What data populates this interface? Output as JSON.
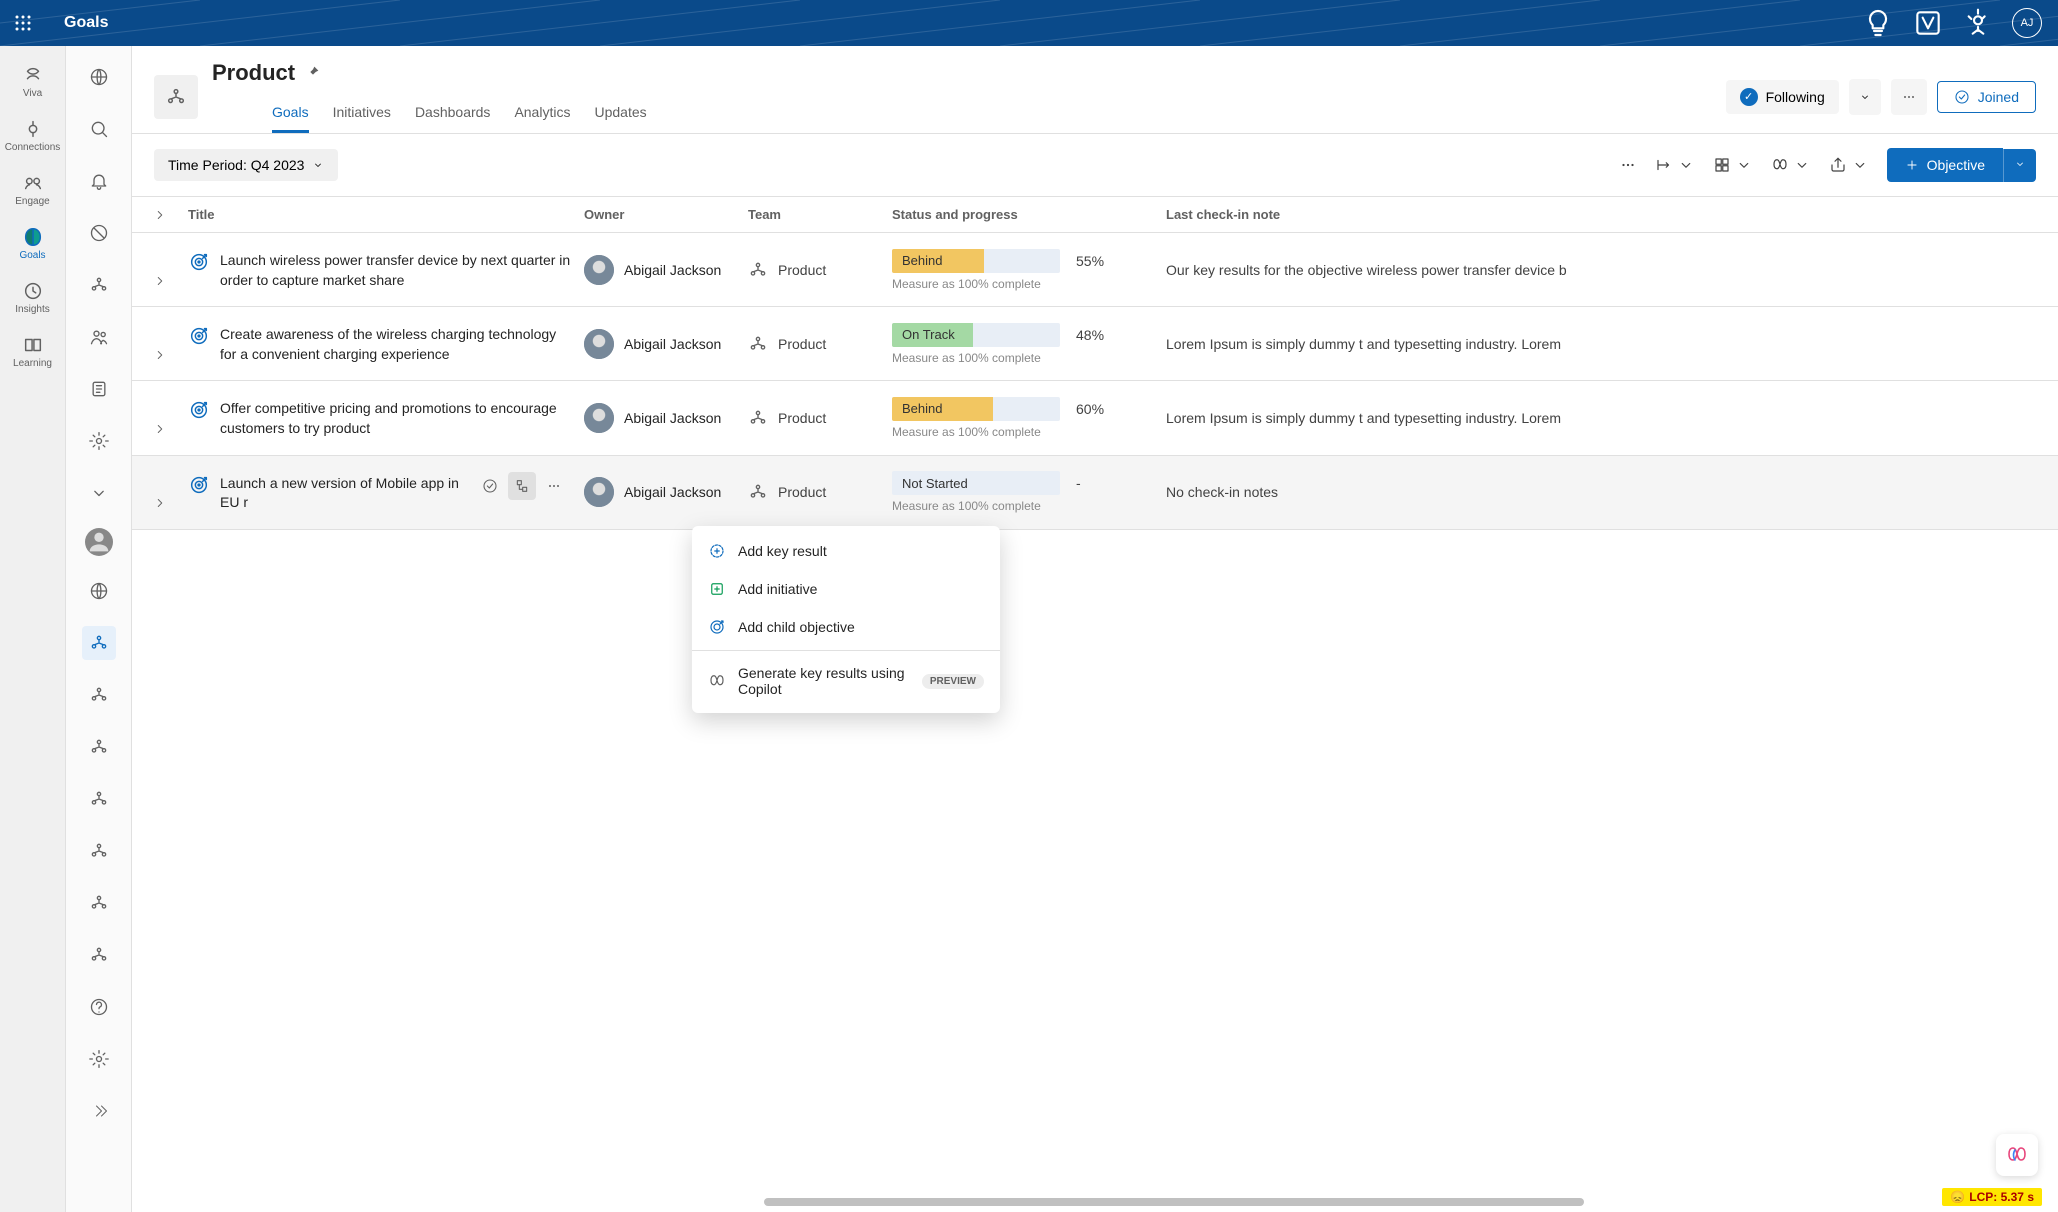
{
  "header": {
    "app_title": "Goals",
    "avatar_initials": "AJ"
  },
  "left_rail": {
    "items": [
      {
        "label": "Viva"
      },
      {
        "label": "Connections"
      },
      {
        "label": "Engage"
      },
      {
        "label": "Goals"
      },
      {
        "label": "Insights"
      },
      {
        "label": "Learning"
      }
    ]
  },
  "page": {
    "title": "Product",
    "following_label": "Following",
    "joined_label": "Joined",
    "tabs": [
      "Goals",
      "Initiatives",
      "Dashboards",
      "Analytics",
      "Updates"
    ],
    "active_tab": "Goals"
  },
  "toolbar": {
    "time_period": "Time Period: Q4 2023",
    "objective_label": "Objective"
  },
  "table": {
    "headers": {
      "title": "Title",
      "owner": "Owner",
      "team": "Team",
      "status": "Status and progress",
      "note": "Last check-in note"
    },
    "rows": [
      {
        "title": "Launch wireless power transfer device by next quarter in order to capture market share",
        "owner": "Abigail Jackson",
        "team": "Product",
        "status_label": "Behind",
        "status_kind": "behind",
        "percent": "55%",
        "fill": 55,
        "measure": "Measure as 100% complete",
        "note": "Our key results for the objective wireless power transfer device b"
      },
      {
        "title": "Create awareness of the wireless charging technology for a convenient charging experience",
        "owner": "Abigail Jackson",
        "team": "Product",
        "status_label": "On Track",
        "status_kind": "ontrack",
        "percent": "48%",
        "fill": 48,
        "measure": "Measure as 100% complete",
        "note": "Lorem Ipsum is simply dummy t and typesetting industry. Lorem"
      },
      {
        "title": "Offer competitive pricing and promotions to encourage customers to try product",
        "owner": "Abigail Jackson",
        "team": "Product",
        "status_label": "Behind",
        "status_kind": "behind",
        "percent": "60%",
        "fill": 60,
        "measure": "Measure as 100% complete",
        "note": "Lorem Ipsum is simply dummy t and typesetting industry. Lorem"
      },
      {
        "title": "Launch a new version of Mobile app in EU r",
        "owner": "Abigail Jackson",
        "team": "Product",
        "status_label": "Not Started",
        "status_kind": "notstarted",
        "percent": "-",
        "fill": 0,
        "measure": "Measure as 100% complete",
        "note": "No check-in notes",
        "hover": true
      }
    ]
  },
  "context_menu": {
    "add_key_result": "Add key result",
    "add_initiative": "Add initiative",
    "add_child_objective": "Add child objective",
    "generate_copilot": "Generate key results using Copilot",
    "preview_badge": "PREVIEW"
  },
  "lcp": "LCP: 5.37 s"
}
